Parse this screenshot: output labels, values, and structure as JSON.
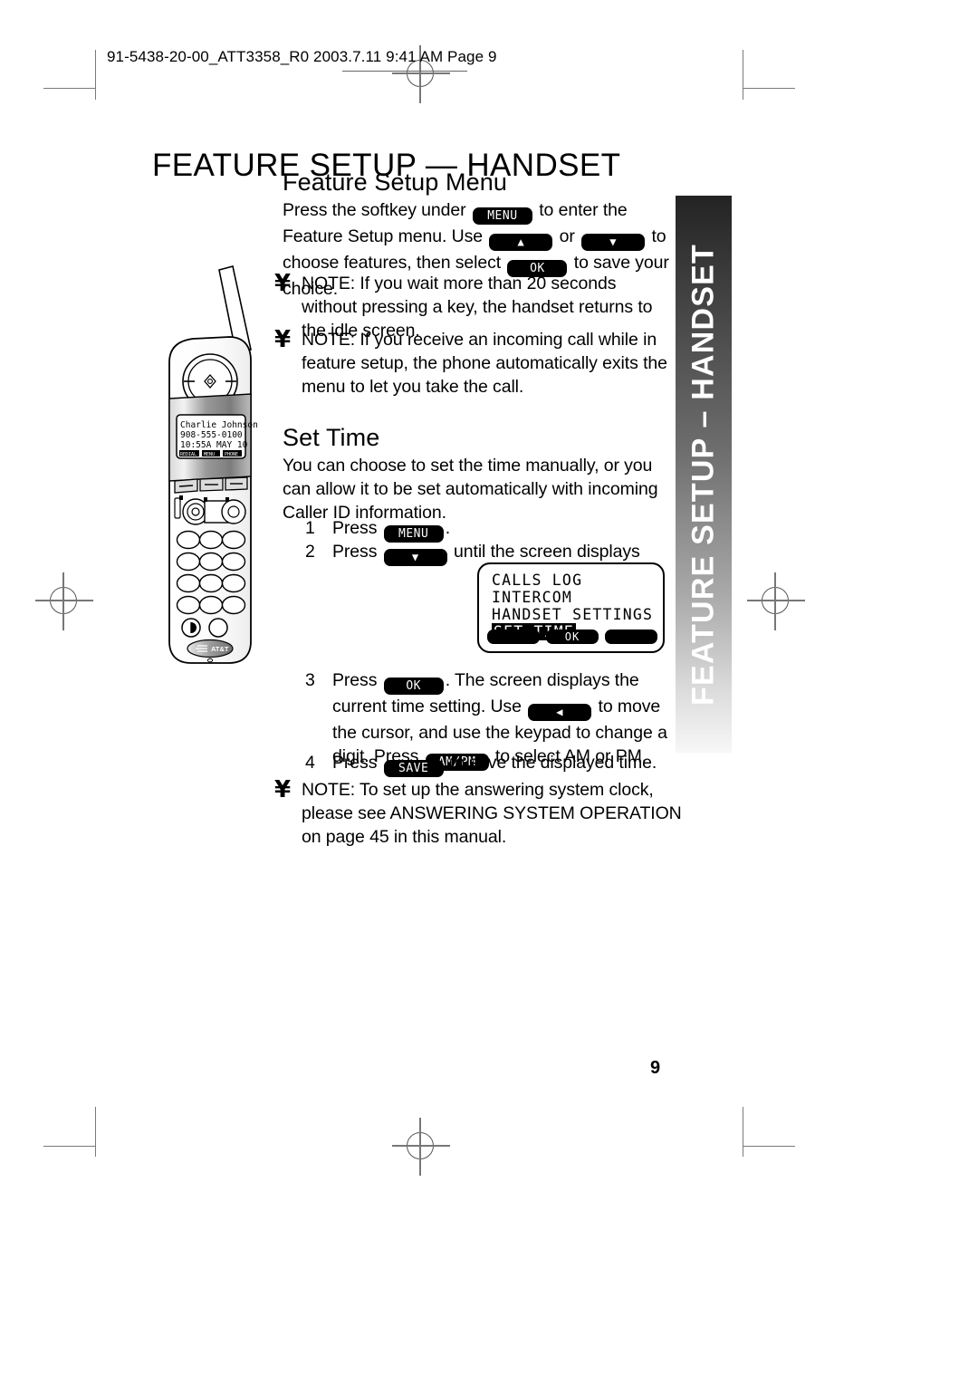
{
  "header": {
    "slug": "91-5438-20-00_ATT3358_R0  2003.7.11  9:41 AM  Page 9"
  },
  "page_title": "FEATURE SETUP — HANDSET",
  "side_tab": {
    "label": "FEATURE SETUP – HANDSET"
  },
  "page_number": "9",
  "sections": {
    "feature_setup_menu": {
      "heading": "Feature Setup Menu",
      "intro_1": "Press the softkey under",
      "key_menu": "MENU",
      "intro_2": "to enter the Feature Setup menu.  Use",
      "key_up": "▲",
      "intro_3": "or",
      "key_down": "▼",
      "intro_4": "to choose features, then select",
      "key_ok": "OK",
      "intro_5": "to save your choice."
    },
    "note_1": {
      "icon": "yen-note-icon",
      "symbol": "¥",
      "text": "NOTE:  If you wait more than 20 seconds without pressing a key, the handset returns to the idle screen."
    },
    "note_2": {
      "icon": "yen-note-icon",
      "symbol": "¥",
      "text": "NOTE:  If you receive an incoming call while in feature setup, the phone automatically exits the menu to let you take the call."
    },
    "set_time": {
      "heading": "Set Time",
      "intro": "You can choose to set the time manually, or you can allow it to be set automatically with incoming Caller ID information.",
      "steps": [
        {
          "num": "1",
          "pre": "Press",
          "key": "MENU",
          "post": "."
        },
        {
          "num": "2",
          "pre": "Press",
          "key": "▼",
          "post": "until the screen displays"
        },
        {
          "num": "3",
          "pre": "Press",
          "key": "OK",
          "post": ". The screen displays the current time setting.  Use",
          "key2": "◀",
          "post2": "to move the cursor, and use the keypad to change a digit. Press",
          "key3": "AM/PM",
          "post3": "to select AM or PM."
        },
        {
          "num": "4",
          "pre": "Press",
          "key": "SAVE",
          "post": "to save the displayed time."
        }
      ]
    },
    "note_3": {
      "icon": "yen-note-icon",
      "symbol": "¥",
      "text": "NOTE: To set up the answering system clock, please see ANSWERING SYSTEM OPERATION on page 45 in this manual."
    }
  },
  "lcd_menu": {
    "lines": [
      "CALLS LOG",
      "INTERCOM",
      "HANDSET SETTINGS"
    ],
    "selected": "SET TIME",
    "softkeys": [
      "",
      "OK",
      ""
    ]
  },
  "handset_display": {
    "name": "Charlie Johnson",
    "number": "908-555-0100",
    "timestamp": "10:55A MAY 10",
    "softkeys": [
      "REDIAL",
      "MENU",
      "PHONE"
    ]
  },
  "brand": {
    "logo_text": "AT&T"
  },
  "colors": {
    "ink": "#000000",
    "tab_dark": "#232323",
    "tab_light": "#f7f7f7",
    "rule": "#7a7a7a"
  }
}
